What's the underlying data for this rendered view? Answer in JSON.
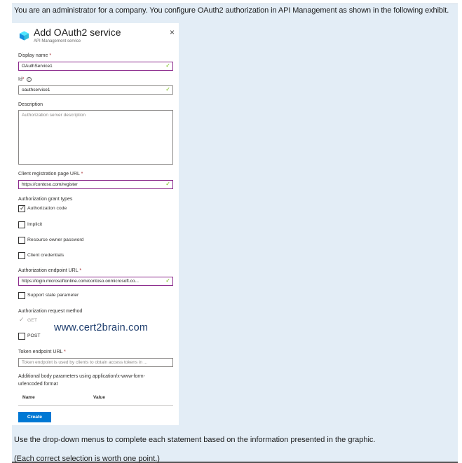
{
  "question": {
    "intro": "You are an administrator for a company. You configure OAuth2 authorization in API Management as shown in the following exhibit.",
    "instruction": "Use the drop-down menus to complete each statement based on the information presented in the graphic.",
    "note": "(Each correct selection is worth one point.)"
  },
  "panel": {
    "title": "Add OAuth2 service",
    "subtitle": "API Management service",
    "icon": "api-management-cube-icon",
    "close_glyph": "×"
  },
  "form": {
    "display_name": {
      "label": "Display name",
      "required": "*",
      "value": "OAuthService1"
    },
    "id": {
      "label": "Id",
      "required": "*",
      "info_glyph": "i",
      "value": "oauthservice1"
    },
    "description": {
      "label": "Description",
      "placeholder": "Authorization server description"
    },
    "client_registration_url": {
      "label": "Client registration page URL",
      "required": "*",
      "value": "https://contoso.com/register"
    },
    "grant_types": {
      "label": "Authorization grant types",
      "items": [
        {
          "label": "Authorization code",
          "checked": true
        },
        {
          "label": "Implicit",
          "checked": false
        },
        {
          "label": "Resource owner password",
          "checked": false
        },
        {
          "label": "Client credentials",
          "checked": false
        }
      ]
    },
    "authorization_endpoint": {
      "label": "Authorization endpoint URL",
      "required": "*",
      "value": "https://login.microsoftonline.com/contoso.onmicrosoft.co..."
    },
    "support_state": {
      "label": "Support state parameter",
      "checked": false
    },
    "request_method": {
      "label": "Authorization request method",
      "items": [
        {
          "label": "GET",
          "checked": true,
          "disabled": true
        },
        {
          "label": "POST",
          "checked": false
        }
      ]
    },
    "token_endpoint": {
      "label": "Token endpoint URL",
      "required": "*",
      "placeholder": "Token endpoint is used by clients to obtain access tokens in ..."
    },
    "body_params": {
      "label_line1": "Additional body parameters using application/x-www-form-",
      "label_line2": "urlencoded format",
      "columns": [
        "Name",
        "Value"
      ]
    },
    "create_label": "Create"
  },
  "watermark": "www.cert2brain.com",
  "colors": {
    "accent": "#0078d4",
    "valid_check": "#6bb700",
    "focus_border": "#8b2a8c",
    "background": "#e3edf6"
  },
  "glyphs": {
    "valid": "✓"
  }
}
